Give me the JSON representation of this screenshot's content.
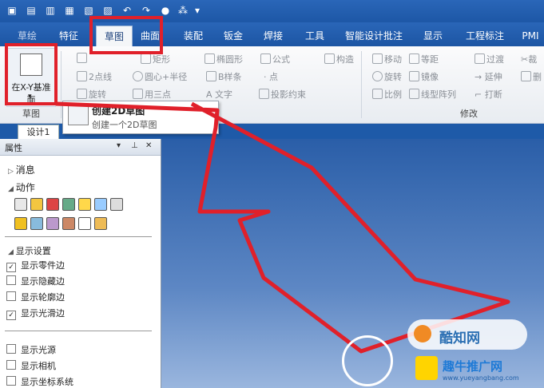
{
  "ribbon_tabs": [
    {
      "label": "草图",
      "active": true
    },
    {
      "label": "曲面"
    },
    {
      "label": "装配"
    },
    {
      "label": "钣金"
    },
    {
      "label": "焊接"
    },
    {
      "label": "工具"
    },
    {
      "label": "智能设计批注"
    },
    {
      "label": "显示"
    },
    {
      "label": "工程标注"
    },
    {
      "label": "PMI"
    }
  ],
  "ribbon_partial_tabs": [
    "特征",
    "草绘"
  ],
  "ribbon": {
    "big_button_label": "在X-Y基准面",
    "group_sketch": "草图",
    "group_modify": "修改",
    "items_draw": [
      "2点线",
      "圆心+半径",
      "旋转",
      "用三点",
      "投影约束",
      "B样条",
      "点",
      "椭圆形",
      "公式",
      "文字",
      "构造",
      "矩形"
    ],
    "items_modify": [
      "移动",
      "等距",
      "过渡",
      "裁",
      "旋转",
      "镜像",
      "延伸",
      "删",
      "比例",
      "线型阵列",
      "打断"
    ]
  },
  "tooltip": {
    "title": "创建2D草图",
    "desc": "创建一个2D草图"
  },
  "doc_tab": "设计1",
  "panel": {
    "title": "属性",
    "sections": {
      "messages": "消息",
      "actions": "动作",
      "display_settings": "显示设置"
    },
    "checkboxes": [
      {
        "label": "显示零件边",
        "checked": true
      },
      {
        "label": "显示隐藏边",
        "checked": false
      },
      {
        "label": "显示轮廓边",
        "checked": false
      },
      {
        "label": "显示光滑边",
        "checked": true
      },
      {
        "label": "显示光源",
        "checked": false
      },
      {
        "label": "显示相机",
        "checked": false
      },
      {
        "label": "显示坐标系统",
        "checked": false
      }
    ]
  },
  "watermark": {
    "brand": "酷知网",
    "site": "趣牛推广网",
    "url": "www.yueyangbang.com"
  },
  "colors": {
    "accent": "#1e5aa8",
    "highlight": "#e0202a"
  }
}
